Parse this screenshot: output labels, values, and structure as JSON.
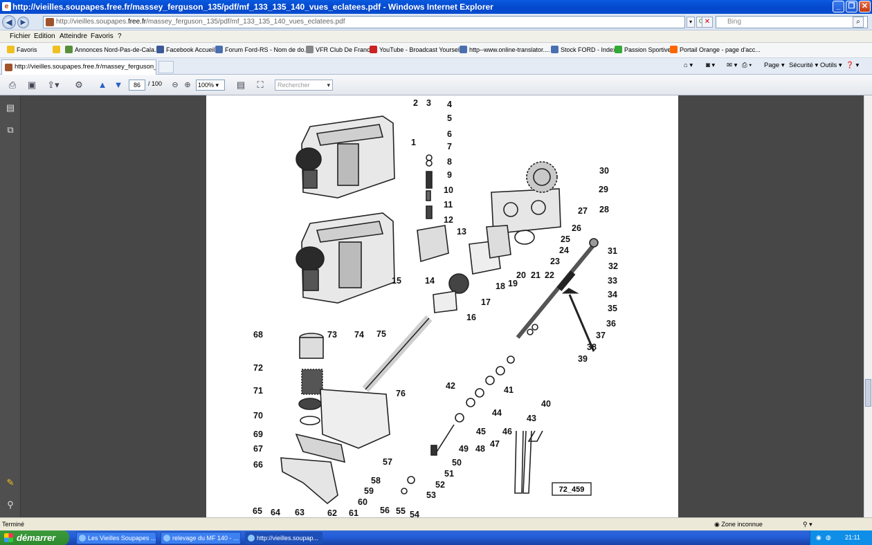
{
  "window": {
    "title": "http://vieilles.soupapes.free.fr/massey_ferguson_135/pdf/mf_133_135_140_vues_eclatees.pdf - Windows Internet Explorer"
  },
  "address": {
    "url_prefix": "http://vieilles.soupapes.",
    "url_host": "free.fr",
    "url_path": "/massey_ferguson_135/pdf/mf_133_135_140_vues_eclatees.pdf",
    "search_placeholder": "Bing"
  },
  "menu": [
    "Fichier",
    "Edition",
    "Atteindre",
    "Favoris",
    "?"
  ],
  "favorites": {
    "label": "Favoris",
    "items": [
      {
        "label": "Annonces Nord-Pas-de-Cala...",
        "color": "#5a8f3a"
      },
      {
        "label": "Facebook  Accueil",
        "color": "#3b5998"
      },
      {
        "label": "Forum Ford-RS - Nom de do...",
        "color": "#4a6fb0"
      },
      {
        "label": "VFR Club De France",
        "color": "#888888"
      },
      {
        "label": "YouTube - Broadcast Yourself.",
        "color": "#cc2222"
      },
      {
        "label": "http--www.online-translator....",
        "color": "#4a6fb0"
      },
      {
        "label": "Stock FORD - Index",
        "color": "#4a6fb0"
      },
      {
        "label": "Passion Sportive",
        "color": "#33aa33"
      },
      {
        "label": "Portail Orange - page d'acc...",
        "color": "#ff6600"
      }
    ]
  },
  "tab": {
    "label": "http://vieilles.soupapes.free.fr/massey_ferguson_13..."
  },
  "commands": {
    "page": "Page",
    "security": "Sécurité",
    "tools": "Outils"
  },
  "pdf": {
    "page_current": "86",
    "page_total": "/ 100",
    "zoom": "100%",
    "find_placeholder": "Rechercher"
  },
  "drawing": {
    "ref_label": "72_459",
    "parts": [
      "1",
      "2",
      "3",
      "4",
      "5",
      "6",
      "7",
      "8",
      "9",
      "10",
      "11",
      "12",
      "13",
      "14",
      "15",
      "16",
      "17",
      "18",
      "19",
      "20",
      "21",
      "22",
      "23",
      "24",
      "25",
      "26",
      "27",
      "28",
      "29",
      "30",
      "31",
      "32",
      "33",
      "34",
      "35",
      "36",
      "37",
      "38",
      "39",
      "40",
      "41",
      "42",
      "43",
      "44",
      "45",
      "46",
      "47",
      "48",
      "49",
      "50",
      "51",
      "52",
      "53",
      "54",
      "55",
      "56",
      "57",
      "58",
      "59",
      "60",
      "61",
      "62",
      "63",
      "64",
      "65",
      "66",
      "67",
      "68",
      "69",
      "70",
      "71",
      "72",
      "73",
      "74",
      "75",
      "76"
    ]
  },
  "status": {
    "left": "Terminé",
    "zone": "Zone inconnue"
  },
  "taskbar": {
    "start": "démarrer",
    "tasks": [
      "Les Vieilles Soupapes ...",
      "relevage du MF 140 - ...",
      "http://vieilles.soupap..."
    ],
    "lang": "FR",
    "clock": "21:11"
  }
}
